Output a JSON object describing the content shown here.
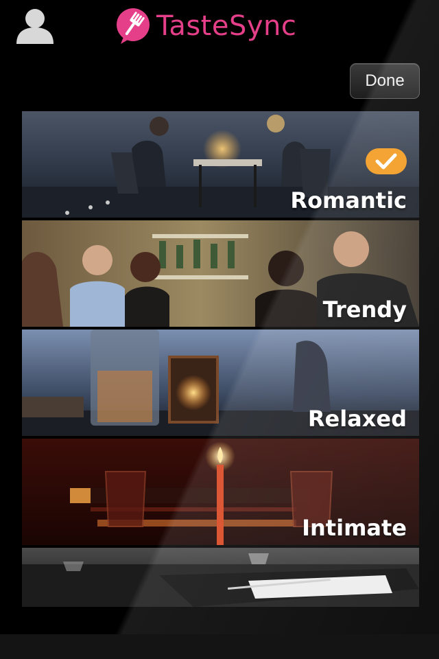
{
  "header": {
    "brand_name": "TasteSync",
    "done_label": "Done"
  },
  "moods": [
    {
      "label": "Romantic",
      "selected": true
    },
    {
      "label": "Trendy",
      "selected": false
    },
    {
      "label": "Relaxed",
      "selected": false
    },
    {
      "label": "Intimate",
      "selected": false
    },
    {
      "label": "",
      "selected": false
    }
  ],
  "colors": {
    "brand_pink": "#e63f8a",
    "check_orange": "#f29a1e"
  },
  "icons": [
    "user-avatar-icon",
    "fork-chat-bubble-icon",
    "checkmark-icon"
  ]
}
